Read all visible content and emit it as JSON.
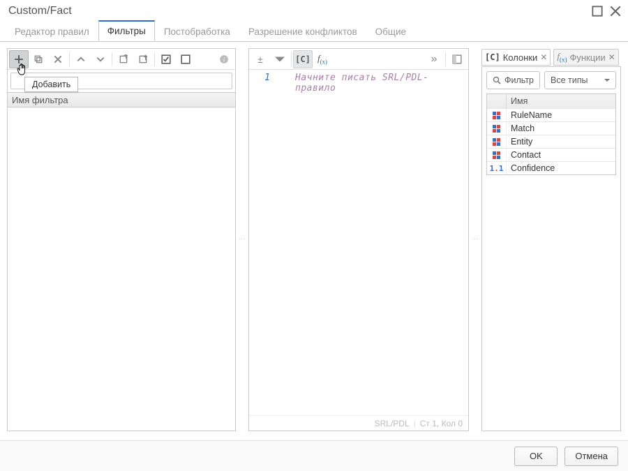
{
  "window": {
    "title": "Custom/Fact"
  },
  "tabs": [
    {
      "label": "Редактор правил"
    },
    {
      "label": "Фильтры"
    },
    {
      "label": "Постобработка"
    },
    {
      "label": "Разрешение конфликтов"
    },
    {
      "label": "Общие"
    }
  ],
  "active_tab_index": 1,
  "left": {
    "tooltip": "Добавить",
    "header": "Имя фильтра"
  },
  "editor": {
    "line_number": "1",
    "placeholder": "Начните писать SRL/PDL-правило",
    "status_lang": "SRL/PDL",
    "status_pos": "Ст 1, Кол 0"
  },
  "right": {
    "tab_columns": "Колонки",
    "tab_functions": "Функции",
    "filter_label": "Фильтр",
    "type_label": "Все типы",
    "header_name": "Имя",
    "rows": [
      {
        "name": "RuleName",
        "kind": "grid"
      },
      {
        "name": "Match",
        "kind": "grid"
      },
      {
        "name": "Entity",
        "kind": "grid"
      },
      {
        "name": "Contact",
        "kind": "grid"
      },
      {
        "name": "Confidence",
        "kind": "num"
      }
    ]
  },
  "footer": {
    "ok": "OK",
    "cancel": "Отмена"
  }
}
